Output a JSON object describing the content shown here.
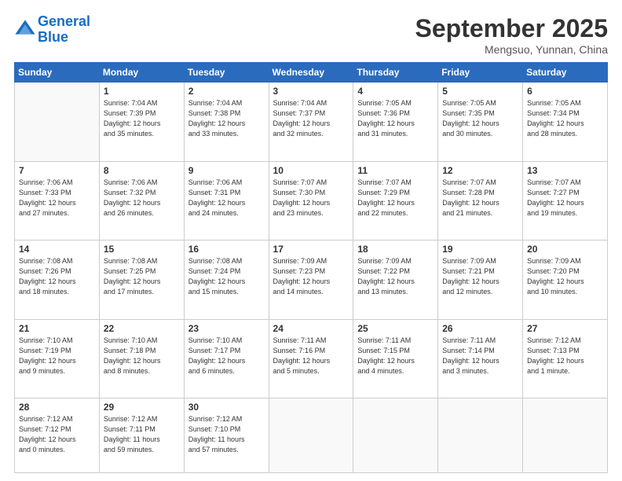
{
  "header": {
    "logo_line1": "General",
    "logo_line2": "Blue",
    "month": "September 2025",
    "location": "Mengsuo, Yunnan, China"
  },
  "days_of_week": [
    "Sunday",
    "Monday",
    "Tuesday",
    "Wednesday",
    "Thursday",
    "Friday",
    "Saturday"
  ],
  "weeks": [
    [
      {
        "day": "",
        "info": ""
      },
      {
        "day": "1",
        "info": "Sunrise: 7:04 AM\nSunset: 7:39 PM\nDaylight: 12 hours\nand 35 minutes."
      },
      {
        "day": "2",
        "info": "Sunrise: 7:04 AM\nSunset: 7:38 PM\nDaylight: 12 hours\nand 33 minutes."
      },
      {
        "day": "3",
        "info": "Sunrise: 7:04 AM\nSunset: 7:37 PM\nDaylight: 12 hours\nand 32 minutes."
      },
      {
        "day": "4",
        "info": "Sunrise: 7:05 AM\nSunset: 7:36 PM\nDaylight: 12 hours\nand 31 minutes."
      },
      {
        "day": "5",
        "info": "Sunrise: 7:05 AM\nSunset: 7:35 PM\nDaylight: 12 hours\nand 30 minutes."
      },
      {
        "day": "6",
        "info": "Sunrise: 7:05 AM\nSunset: 7:34 PM\nDaylight: 12 hours\nand 28 minutes."
      }
    ],
    [
      {
        "day": "7",
        "info": "Sunrise: 7:06 AM\nSunset: 7:33 PM\nDaylight: 12 hours\nand 27 minutes."
      },
      {
        "day": "8",
        "info": "Sunrise: 7:06 AM\nSunset: 7:32 PM\nDaylight: 12 hours\nand 26 minutes."
      },
      {
        "day": "9",
        "info": "Sunrise: 7:06 AM\nSunset: 7:31 PM\nDaylight: 12 hours\nand 24 minutes."
      },
      {
        "day": "10",
        "info": "Sunrise: 7:07 AM\nSunset: 7:30 PM\nDaylight: 12 hours\nand 23 minutes."
      },
      {
        "day": "11",
        "info": "Sunrise: 7:07 AM\nSunset: 7:29 PM\nDaylight: 12 hours\nand 22 minutes."
      },
      {
        "day": "12",
        "info": "Sunrise: 7:07 AM\nSunset: 7:28 PM\nDaylight: 12 hours\nand 21 minutes."
      },
      {
        "day": "13",
        "info": "Sunrise: 7:07 AM\nSunset: 7:27 PM\nDaylight: 12 hours\nand 19 minutes."
      }
    ],
    [
      {
        "day": "14",
        "info": "Sunrise: 7:08 AM\nSunset: 7:26 PM\nDaylight: 12 hours\nand 18 minutes."
      },
      {
        "day": "15",
        "info": "Sunrise: 7:08 AM\nSunset: 7:25 PM\nDaylight: 12 hours\nand 17 minutes."
      },
      {
        "day": "16",
        "info": "Sunrise: 7:08 AM\nSunset: 7:24 PM\nDaylight: 12 hours\nand 15 minutes."
      },
      {
        "day": "17",
        "info": "Sunrise: 7:09 AM\nSunset: 7:23 PM\nDaylight: 12 hours\nand 14 minutes."
      },
      {
        "day": "18",
        "info": "Sunrise: 7:09 AM\nSunset: 7:22 PM\nDaylight: 12 hours\nand 13 minutes."
      },
      {
        "day": "19",
        "info": "Sunrise: 7:09 AM\nSunset: 7:21 PM\nDaylight: 12 hours\nand 12 minutes."
      },
      {
        "day": "20",
        "info": "Sunrise: 7:09 AM\nSunset: 7:20 PM\nDaylight: 12 hours\nand 10 minutes."
      }
    ],
    [
      {
        "day": "21",
        "info": "Sunrise: 7:10 AM\nSunset: 7:19 PM\nDaylight: 12 hours\nand 9 minutes."
      },
      {
        "day": "22",
        "info": "Sunrise: 7:10 AM\nSunset: 7:18 PM\nDaylight: 12 hours\nand 8 minutes."
      },
      {
        "day": "23",
        "info": "Sunrise: 7:10 AM\nSunset: 7:17 PM\nDaylight: 12 hours\nand 6 minutes."
      },
      {
        "day": "24",
        "info": "Sunrise: 7:11 AM\nSunset: 7:16 PM\nDaylight: 12 hours\nand 5 minutes."
      },
      {
        "day": "25",
        "info": "Sunrise: 7:11 AM\nSunset: 7:15 PM\nDaylight: 12 hours\nand 4 minutes."
      },
      {
        "day": "26",
        "info": "Sunrise: 7:11 AM\nSunset: 7:14 PM\nDaylight: 12 hours\nand 3 minutes."
      },
      {
        "day": "27",
        "info": "Sunrise: 7:12 AM\nSunset: 7:13 PM\nDaylight: 12 hours\nand 1 minute."
      }
    ],
    [
      {
        "day": "28",
        "info": "Sunrise: 7:12 AM\nSunset: 7:12 PM\nDaylight: 12 hours\nand 0 minutes."
      },
      {
        "day": "29",
        "info": "Sunrise: 7:12 AM\nSunset: 7:11 PM\nDaylight: 11 hours\nand 59 minutes."
      },
      {
        "day": "30",
        "info": "Sunrise: 7:12 AM\nSunset: 7:10 PM\nDaylight: 11 hours\nand 57 minutes."
      },
      {
        "day": "",
        "info": ""
      },
      {
        "day": "",
        "info": ""
      },
      {
        "day": "",
        "info": ""
      },
      {
        "day": "",
        "info": ""
      }
    ]
  ]
}
